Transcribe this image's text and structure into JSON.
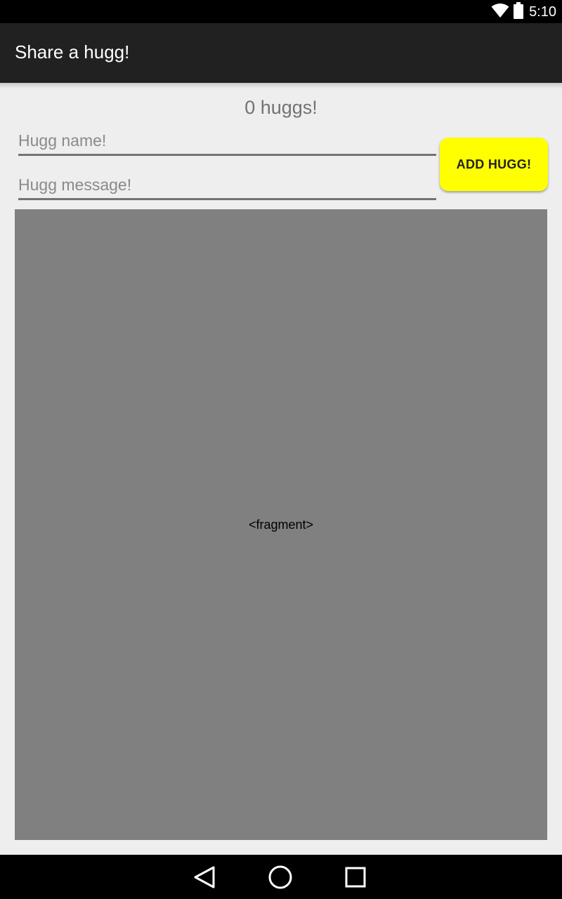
{
  "status_bar": {
    "time": "5:10",
    "icons": [
      "wifi-icon",
      "battery-icon"
    ]
  },
  "app_bar": {
    "title": "Share a hugg!",
    "background": "#212121"
  },
  "main": {
    "counter_text": "0 huggs!",
    "name_field": {
      "value": "",
      "placeholder": "Hugg name!"
    },
    "message_field": {
      "value": "",
      "placeholder": "Hugg message!"
    },
    "add_button": {
      "label": "ADD HUGG!",
      "color": "#ffff00"
    },
    "fragment": {
      "label": "<fragment>",
      "background": "#808080"
    }
  },
  "nav_bar": {
    "icons": [
      "back-icon",
      "home-icon",
      "recents-icon"
    ]
  }
}
